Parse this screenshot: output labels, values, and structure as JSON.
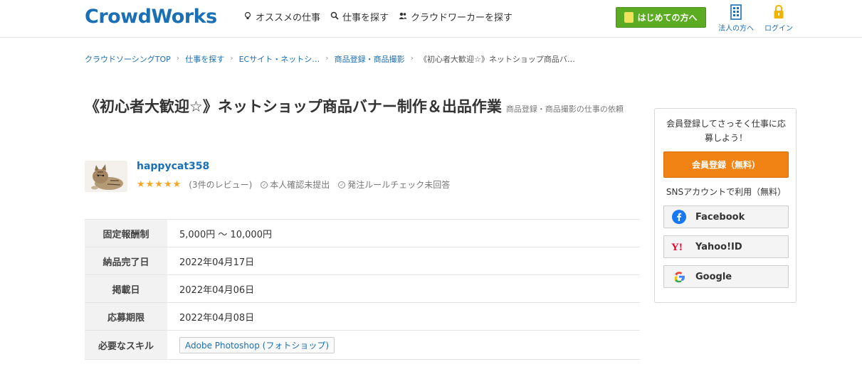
{
  "header": {
    "logo": "CrowdWorks",
    "nav": [
      {
        "label": "オススメの仕事",
        "icon": "lightbulb-icon"
      },
      {
        "label": "仕事を探す",
        "icon": "search-icon"
      },
      {
        "label": "クラウドワーカーを探す",
        "icon": "users-icon"
      }
    ],
    "start_button": "はじめての方へ",
    "corporate_label": "法人の方へ",
    "login_label": "ログイン"
  },
  "breadcrumb": [
    "クラウドソーシングTOP",
    "仕事を探す",
    "ECサイト・ネットシ…",
    "商品登録・商品撮影",
    "《初心者大歓迎☆》ネットショップ商品バ…"
  ],
  "job": {
    "title": "《初心者大歓迎☆》ネットショップ商品バナー制作＆出品作業",
    "category_suffix": "商品登録・商品撮影の仕事の依頼"
  },
  "client": {
    "name": "happycat358",
    "stars": "★★★★★",
    "reviews": "(3件のレビュー)",
    "identity": "本人確認未提出",
    "rule_check": "発注ルールチェック未回答"
  },
  "details": [
    {
      "label": "固定報酬制",
      "value": "5,000円 〜 10,000円"
    },
    {
      "label": "納品完了日",
      "value": "2022年04月17日"
    },
    {
      "label": "掲載日",
      "value": "2022年04月06日"
    },
    {
      "label": "応募期限",
      "value": "2022年04月08日"
    },
    {
      "label": "必要なスキル",
      "value": "Adobe Photoshop (フォトショップ)"
    }
  ],
  "sidebar": {
    "message": "会員登録してさっそく仕事に応募しよう！",
    "register_button": "会員登録（無料）",
    "sns_label": "SNSアカウントで利用（無料）",
    "sns_buttons": [
      {
        "label": "Facebook",
        "icon": "facebook-icon"
      },
      {
        "label": "Yahoo!ID",
        "icon": "yahoo-icon"
      },
      {
        "label": "Google",
        "icon": "google-icon"
      }
    ]
  },
  "colors": {
    "brand_blue": "#1b6fb5",
    "start_green": "#5cac23",
    "register_orange": "#f08313",
    "star_gold": "#f5a623"
  }
}
